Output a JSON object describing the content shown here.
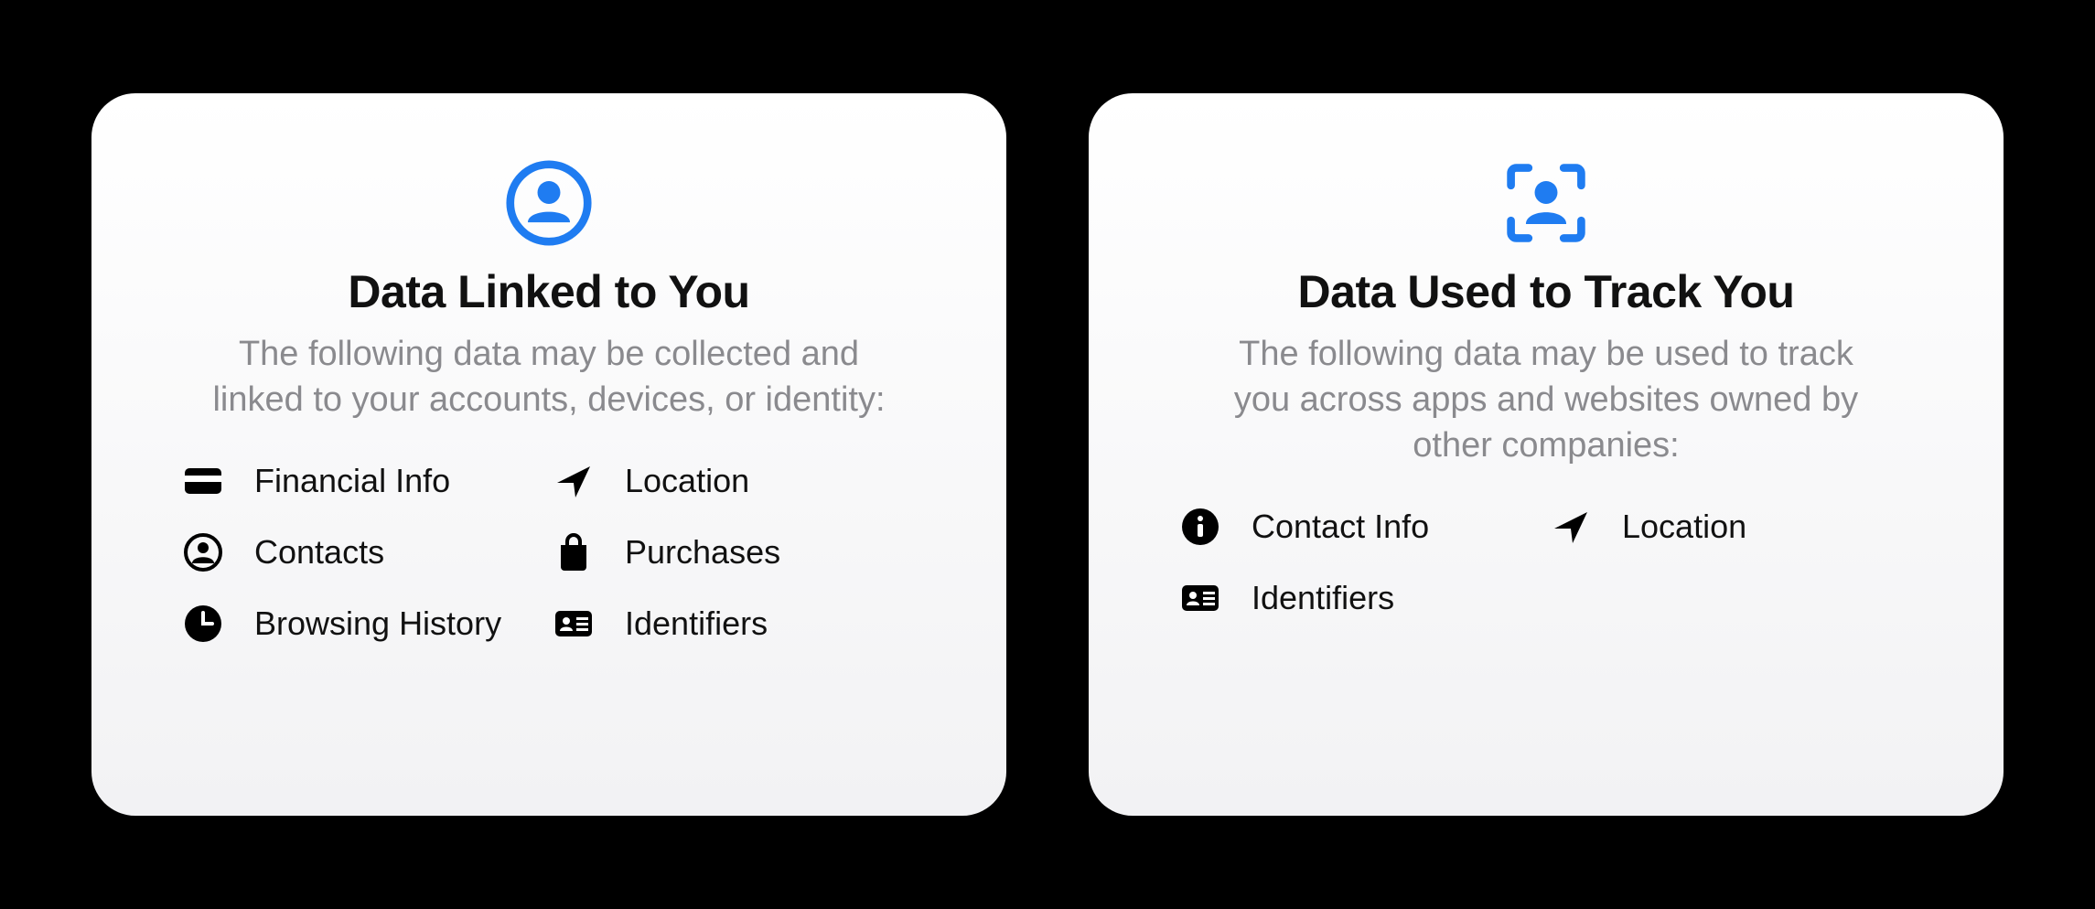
{
  "cards": {
    "linked": {
      "title": "Data Linked to You",
      "description": "The following data may be collected and linked to your accounts, devices, or identity:",
      "items": [
        {
          "label": "Financial Info",
          "icon": "credit-card-icon"
        },
        {
          "label": "Location",
          "icon": "location-arrow-icon"
        },
        {
          "label": "Contacts",
          "icon": "contacts-circle-icon"
        },
        {
          "label": "Purchases",
          "icon": "shopping-bag-icon"
        },
        {
          "label": "Browsing History",
          "icon": "clock-icon"
        },
        {
          "label": "Identifiers",
          "icon": "id-card-icon"
        }
      ]
    },
    "track": {
      "title": "Data Used to Track You",
      "description": "The following data may be used to track you across apps and websites owned by other companies:",
      "items": [
        {
          "label": "Contact Info",
          "icon": "info-circle-icon"
        },
        {
          "label": "Location",
          "icon": "location-arrow-icon"
        },
        {
          "label": "Identifiers",
          "icon": "id-card-icon"
        }
      ]
    }
  },
  "colors": {
    "accent": "#1f7cf1"
  }
}
